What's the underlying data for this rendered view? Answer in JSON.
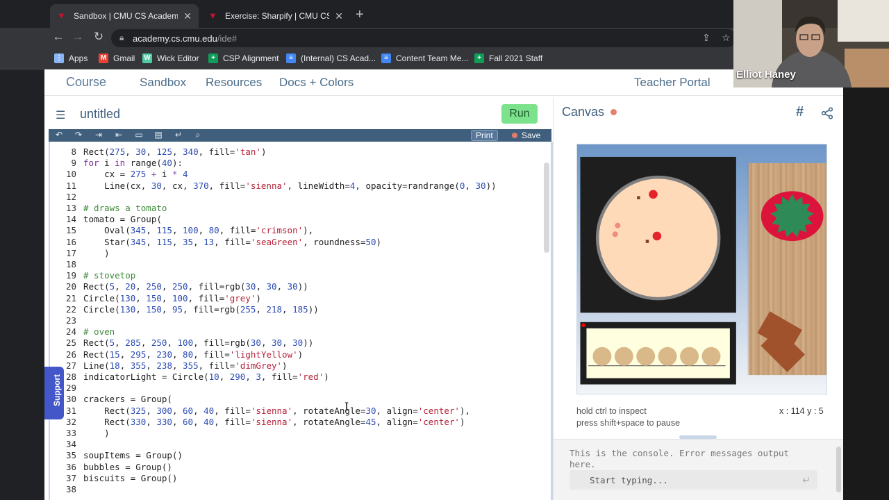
{
  "browser": {
    "tabs": [
      {
        "title": "Sandbox | CMU CS Academy",
        "active": true
      },
      {
        "title": "Exercise: Sharpify | CMU CS Ac",
        "active": false
      }
    ],
    "url_host": "academy.cs.cmu.edu",
    "url_path": "/ide#",
    "bookmarks": [
      {
        "label": "Apps",
        "icon": "apps-grid-icon",
        "color": "#8ab4f8"
      },
      {
        "label": "Gmail",
        "icon": "gmail-icon",
        "color": "#ea4335"
      },
      {
        "label": "Wick Editor",
        "icon": "wick-icon",
        "color": "#4ecca3"
      },
      {
        "label": "CSP Alignment",
        "icon": "sheets-icon",
        "color": "#0f9d58"
      },
      {
        "label": "(Internal) CS Acad...",
        "icon": "docs-icon",
        "color": "#4285f4"
      },
      {
        "label": "Content Team Me...",
        "icon": "docs-icon",
        "color": "#4285f4"
      },
      {
        "label": "Fall 2021 Staff",
        "icon": "sheets-icon",
        "color": "#0f9d58"
      }
    ]
  },
  "nav": {
    "course": "Course",
    "sandbox": "Sandbox",
    "resources": "Resources",
    "docs": "Docs + Colors",
    "teacher": "Teacher Portal"
  },
  "editor": {
    "menu_icon": "hamburger-icon",
    "title": "untitled",
    "run_label": "Run",
    "print_label": "Print",
    "save_label": "Save",
    "toolbar_icons": [
      "undo-icon",
      "redo-icon",
      "indent-icon",
      "outdent-icon",
      "comment-icon",
      "format-icon",
      "wrap-icon",
      "search-icon"
    ],
    "lines": [
      {
        "n": "8",
        "html": "Rect(<span class=\"n\">275</span>, <span class=\"n\">30</span>, <span class=\"n\">125</span>, <span class=\"n\">340</span>, fill=<span class=\"s\">'tan'</span>)"
      },
      {
        "n": "9",
        "html": "<span class=\"k\">for</span> i <span class=\"k\">in</span> range(<span class=\"n\">40</span>):"
      },
      {
        "n": "10",
        "html": "    cx = <span class=\"n\">275</span> <span class=\"o\">+</span> i <span class=\"o\">*</span> <span class=\"n\">4</span>"
      },
      {
        "n": "11",
        "html": "    Line(cx, <span class=\"n\">30</span>, cx, <span class=\"n\">370</span>, fill=<span class=\"s\">'sienna'</span>, lineWidth=<span class=\"n\">4</span>, opacity=randrange(<span class=\"n\">0</span>, <span class=\"n\">30</span>))"
      },
      {
        "n": "12",
        "html": ""
      },
      {
        "n": "13",
        "html": "<span class=\"c\"># draws a tomato</span>"
      },
      {
        "n": "14",
        "html": "tomato = Group("
      },
      {
        "n": "15",
        "html": "    Oval(<span class=\"n\">345</span>, <span class=\"n\">115</span>, <span class=\"n\">100</span>, <span class=\"n\">80</span>, fill=<span class=\"s\">'crimson'</span>),"
      },
      {
        "n": "16",
        "html": "    Star(<span class=\"n\">345</span>, <span class=\"n\">115</span>, <span class=\"n\">35</span>, <span class=\"n\">13</span>, fill=<span class=\"s\">'seaGreen'</span>, roundness=<span class=\"n\">50</span>)"
      },
      {
        "n": "17",
        "html": "    )"
      },
      {
        "n": "18",
        "html": ""
      },
      {
        "n": "19",
        "html": "<span class=\"c\"># stovetop</span>"
      },
      {
        "n": "20",
        "html": "Rect(<span class=\"n\">5</span>, <span class=\"n\">20</span>, <span class=\"n\">250</span>, <span class=\"n\">250</span>, fill=rgb(<span class=\"n\">30</span>, <span class=\"n\">30</span>, <span class=\"n\">30</span>))"
      },
      {
        "n": "21",
        "html": "Circle(<span class=\"n\">130</span>, <span class=\"n\">150</span>, <span class=\"n\">100</span>, fill=<span class=\"s\">'grey'</span>)"
      },
      {
        "n": "22",
        "html": "Circle(<span class=\"n\">130</span>, <span class=\"n\">150</span>, <span class=\"n\">95</span>, fill=rgb(<span class=\"n\">255</span>, <span class=\"n\">218</span>, <span class=\"n\">185</span>))"
      },
      {
        "n": "23",
        "html": ""
      },
      {
        "n": "24",
        "html": "<span class=\"c\"># oven</span>"
      },
      {
        "n": "25",
        "html": "Rect(<span class=\"n\">5</span>, <span class=\"n\">285</span>, <span class=\"n\">250</span>, <span class=\"n\">100</span>, fill=rgb(<span class=\"n\">30</span>, <span class=\"n\">30</span>, <span class=\"n\">30</span>))"
      },
      {
        "n": "26",
        "html": "Rect(<span class=\"n\">15</span>, <span class=\"n\">295</span>, <span class=\"n\">230</span>, <span class=\"n\">80</span>, fill=<span class=\"s\">'lightYellow'</span>)"
      },
      {
        "n": "27",
        "html": "Line(<span class=\"n\">18</span>, <span class=\"n\">355</span>, <span class=\"n\">238</span>, <span class=\"n\">355</span>, fill=<span class=\"s\">'dimGrey'</span>)"
      },
      {
        "n": "28",
        "html": "indicatorLight = Circle(<span class=\"n\">10</span>, <span class=\"n\">290</span>, <span class=\"n\">3</span>, fill=<span class=\"s\">'red'</span>)"
      },
      {
        "n": "29",
        "html": ""
      },
      {
        "n": "30",
        "html": "crackers = Group("
      },
      {
        "n": "31",
        "html": "    Rect(<span class=\"n\">325</span>, <span class=\"n\">300</span>, <span class=\"n\">60</span>, <span class=\"n\">40</span>, fill=<span class=\"s\">'sienna'</span>, rotateAngle=<span class=\"n\">30</span>, align=<span class=\"s\">'center'</span>),"
      },
      {
        "n": "32",
        "html": "    Rect(<span class=\"n\">330</span>, <span class=\"n\">330</span>, <span class=\"n\">60</span>, <span class=\"n\">40</span>, fill=<span class=\"s\">'sienna'</span>, rotateAngle=<span class=\"n\">45</span>, align=<span class=\"s\">'center'</span>)"
      },
      {
        "n": "33",
        "html": "    )"
      },
      {
        "n": "34",
        "html": ""
      },
      {
        "n": "35",
        "html": "soupItems = Group()"
      },
      {
        "n": "36",
        "html": "bubbles = Group()"
      },
      {
        "n": "37",
        "html": "biscuits = Group()"
      },
      {
        "n": "38",
        "html": ""
      }
    ]
  },
  "support_label": "Support",
  "canvas": {
    "title": "Canvas",
    "hint1": "hold ctrl to inspect",
    "hint2": "press shift+space to pause",
    "x_label": "x : 114",
    "y_label": "y : 5"
  },
  "console": {
    "message": "This is the console. Error messages output here.",
    "placeholder": "Start typing..."
  },
  "webcam": {
    "name": "Elliot Haney"
  }
}
